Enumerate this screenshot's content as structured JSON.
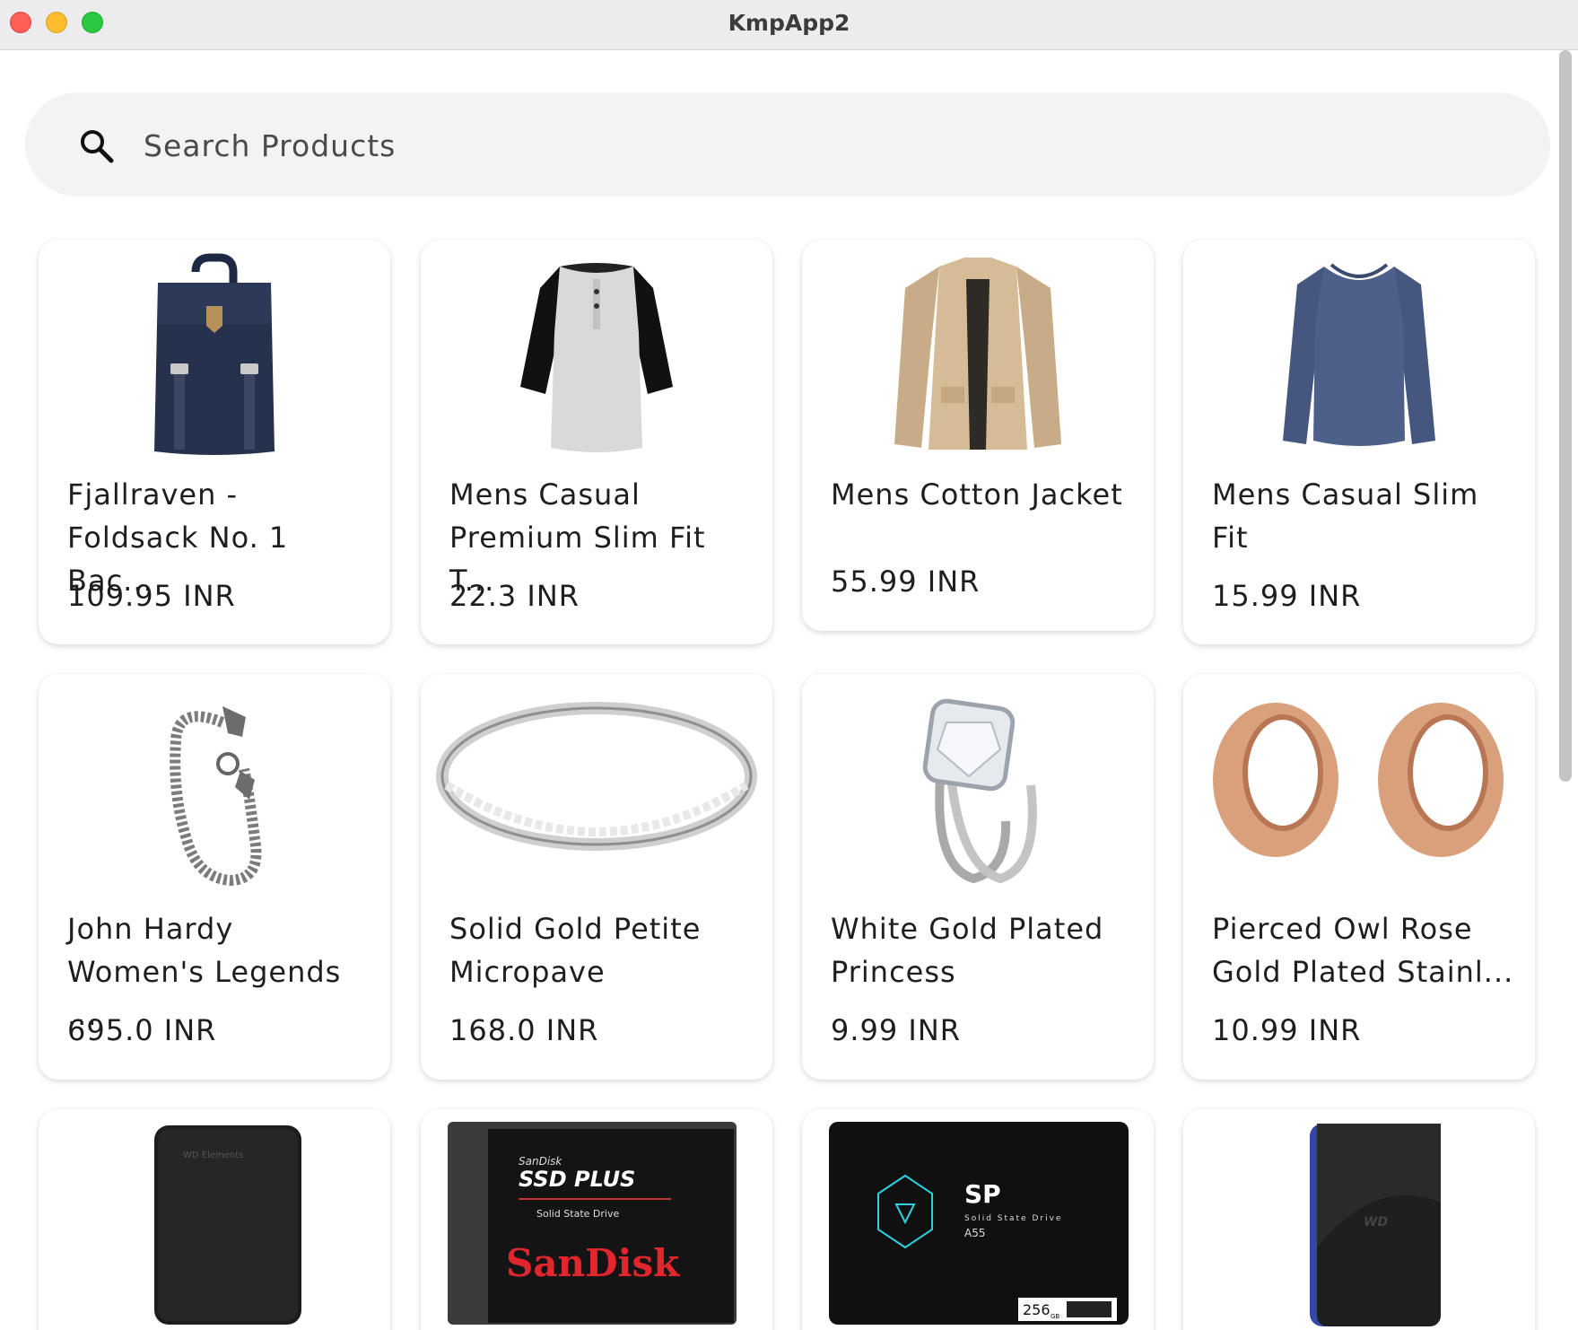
{
  "window": {
    "title": "KmpApp2"
  },
  "search": {
    "placeholder": "Search Products"
  },
  "products": [
    {
      "name": "Fjallraven -\nFoldsack No. 1 Bac...",
      "price": "109.95 INR",
      "icon": "backpack"
    },
    {
      "name": "Mens Casual\nPremium Slim Fit T...",
      "price": "22.3 INR",
      "icon": "raglan-shirt"
    },
    {
      "name": "Mens Cotton Jacket",
      "price": "55.99 INR",
      "icon": "jacket"
    },
    {
      "name": "Mens Casual Slim\nFit",
      "price": "15.99 INR",
      "icon": "long-sleeve-shirt"
    },
    {
      "name": "John Hardy\nWomen's Legends ...",
      "price": "695.0 INR",
      "icon": "bracelet"
    },
    {
      "name": "Solid Gold Petite\nMicropave",
      "price": "168.0 INR",
      "icon": "band-ring"
    },
    {
      "name": "White Gold Plated\nPrincess",
      "price": "9.99 INR",
      "icon": "diamond-ring"
    },
    {
      "name": "Pierced Owl Rose\nGold Plated Stainl...",
      "price": "10.99 INR",
      "icon": "ear-tunnels"
    },
    {
      "name": "",
      "price": "",
      "icon": "external-hard-drive",
      "logo": "WD Elements"
    },
    {
      "name": "",
      "price": "",
      "icon": "ssd-sandisk",
      "line1": "SanDisk",
      "line2": "SSD PLUS",
      "line3": "Solid State Drive",
      "brand": "SanDisk"
    },
    {
      "name": "",
      "price": "",
      "icon": "ssd-silicon-power",
      "brand": "SP",
      "line1": "Solid State Drive",
      "model": "A55",
      "capacity": "256",
      "unit": "GB"
    },
    {
      "name": "",
      "price": "",
      "icon": "portable-drive",
      "logo": "WD"
    }
  ]
}
